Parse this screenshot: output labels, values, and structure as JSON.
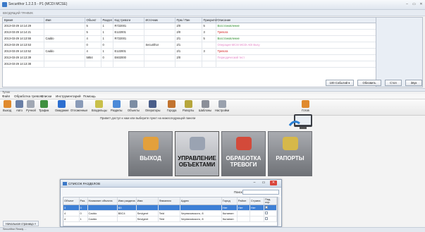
{
  "window": {
    "title": "Securithor 1.2.2.5 - P1 (MCDI MCSE)",
    "minimize": "–",
    "restore": "▭",
    "close": "✕"
  },
  "events_header_label": "ВХОДЯЩИЙ ТРАФИК",
  "events": {
    "columns": [
      "Время",
      "Имя",
      "Объект",
      "Раздел",
      "Код тревоги",
      "Источник",
      "Прм / Пин",
      "Приоритет",
      "Описание"
    ],
    "rows": [
      {
        "time": "2013-03-29 14:14:29",
        "name": "",
        "object": "5",
        "zone": "1",
        "code": "R722001",
        "source": "",
        "pin": "2/0",
        "priority": "5",
        "desc": "Восстановление",
        "desc_color": "green"
      },
      {
        "time": "2013-03-29 14:14:21",
        "name": "",
        "object": "5",
        "zone": "1",
        "code": "E122001",
        "source": "",
        "pin": "2/0",
        "priority": "3",
        "desc": "Тревога",
        "desc_color": "red"
      },
      {
        "time": "2013-03-29 14:13:55",
        "name": "Caddo",
        "object": "4",
        "zone": "1",
        "code": "R722001",
        "source": "",
        "pin": "2/1",
        "priority": "5",
        "desc": "Восстановление",
        "desc_color": "green"
      },
      {
        "time": "2013-03-29 14:13:53",
        "name": "",
        "object": "0",
        "zone": "0",
        "code": "",
        "source": "Securithor",
        "pin": "2/1",
        "priority": "",
        "desc": "Операция MCSI MCDI ADI Busy",
        "desc_color": "pink"
      },
      {
        "time": "2013-03-29 14:13:52",
        "name": "Caddo",
        "object": "4",
        "zone": "1",
        "code": "E122001",
        "source": "",
        "pin": "2/1",
        "priority": "3",
        "desc": "Тревога",
        "desc_color": "red"
      },
      {
        "time": "2013-03-29 14:13:39",
        "name": "",
        "object": "5854",
        "zone": "0",
        "code": "E602000",
        "source": "",
        "pin": "2/0",
        "priority": "",
        "desc": "Периодический тест",
        "desc_color": "pink"
      },
      {
        "time": "2013-03-29 14:13:38",
        "name": "",
        "object": "",
        "zone": "",
        "code": "",
        "source": "",
        "pin": "",
        "priority": "",
        "desc": "",
        "desc_color": "green"
      }
    ],
    "count_select": "100 Событий",
    "refresh_button": "Обновить",
    "stop_button": "Стоп",
    "next_button": "Звук"
  },
  "section_label": "Тупок",
  "menu": [
    "Файл",
    "Обработка тревоги",
    "Списки",
    "Инструментарий",
    "Помощь"
  ],
  "toolbar": [
    {
      "label": "Выход",
      "icon": "exit-icon",
      "color": "#e08a2e"
    },
    {
      "label": "Авто",
      "icon": "auto-icon",
      "color": "#6a7fa6"
    },
    {
      "label": "Ручной",
      "icon": "manual-icon",
      "color": "#a1a8b4"
    },
    {
      "label": "Трафик",
      "icon": "traffic-icon",
      "color": "#3f8f3f"
    },
    {
      "label": "Ожидание",
      "icon": "pending-icon",
      "color": "#2d6fd0"
    },
    {
      "label": "Отложенные",
      "icon": "postponed-icon",
      "color": "#8a9bb8"
    },
    {
      "label": "Владельцы",
      "icon": "owners-icon",
      "color": "#c9c04a"
    },
    {
      "label": "Разделы",
      "icon": "zones-icon",
      "color": "#4c8ad8"
    },
    {
      "label": "Объекты",
      "icon": "objects-icon",
      "color": "#7c8da3"
    },
    {
      "label": "Операторы",
      "icon": "operators-icon",
      "color": "#4a5e8a"
    },
    {
      "label": "Города",
      "icon": "cities-icon",
      "color": "#c2732f"
    },
    {
      "label": "Рапорты",
      "icon": "reports-icon",
      "color": "#b7a63c"
    },
    {
      "label": "Шаблоны",
      "icon": "templates-icon",
      "color": "#8b8f99"
    },
    {
      "label": "Настройки",
      "icon": "settings-icon",
      "color": "#9aa1ad"
    },
    {
      "label": "Готов",
      "icon": "ready-icon",
      "color": "#e08a2e"
    }
  ],
  "hint": "Привет! доступ к нам или выберите пункт на нижеследующей панели",
  "big_buttons": [
    {
      "label": "ВЫХОД",
      "icon": "exit-door-icon",
      "active": false
    },
    {
      "label": "УПРАВЛЕНИЕ ОБЪЕКТАМИ",
      "icon": "objects-management-icon",
      "active": true
    },
    {
      "label": "ОБРАБОТКА ТРЕВОГИ",
      "icon": "alarm-processing-icon",
      "active": false
    },
    {
      "label": "РАПОРТЫ",
      "icon": "reports-clipboard-icon",
      "active": false
    }
  ],
  "dialog": {
    "title": "СПИСОК РАЗДЕЛОВ",
    "search_label": "Поиск:",
    "columns": [
      "Объект",
      "Раз.",
      "Название объекта",
      "Имя раздела",
      "Имя",
      "Фамилия",
      "Адрес",
      "Город",
      "Район",
      "Страна",
      "Под. охр."
    ],
    "rows": [
      {
        "obj": "3",
        "zone": "0",
        "oname": "",
        "zname": "ВЗ",
        "fname": "",
        "lname": "",
        "addr": "",
        "city": "Нет",
        "district": "Нет",
        "country": "Нет",
        "sel": true
      },
      {
        "obj": "4",
        "zone": "0",
        "oname": "Caddo",
        "zname": "B5C4",
        "fname": "Sevigent",
        "lname": "Teid",
        "addr": "Черняховского, 8",
        "city": "Калинин",
        "district": "",
        "country": "",
        "sel": false
      },
      {
        "obj": "4",
        "zone": "1",
        "oname": "Caddo",
        "zname": "",
        "fname": "Sevigent",
        "lname": "Teid",
        "addr": "Черняховского, 8",
        "city": "Калинин",
        "district": "",
        "country": "",
        "sel": false
      }
    ]
  },
  "bottom_tabs": [
    "Начальная страница ×"
  ],
  "status": "Securithor Ready ..."
}
